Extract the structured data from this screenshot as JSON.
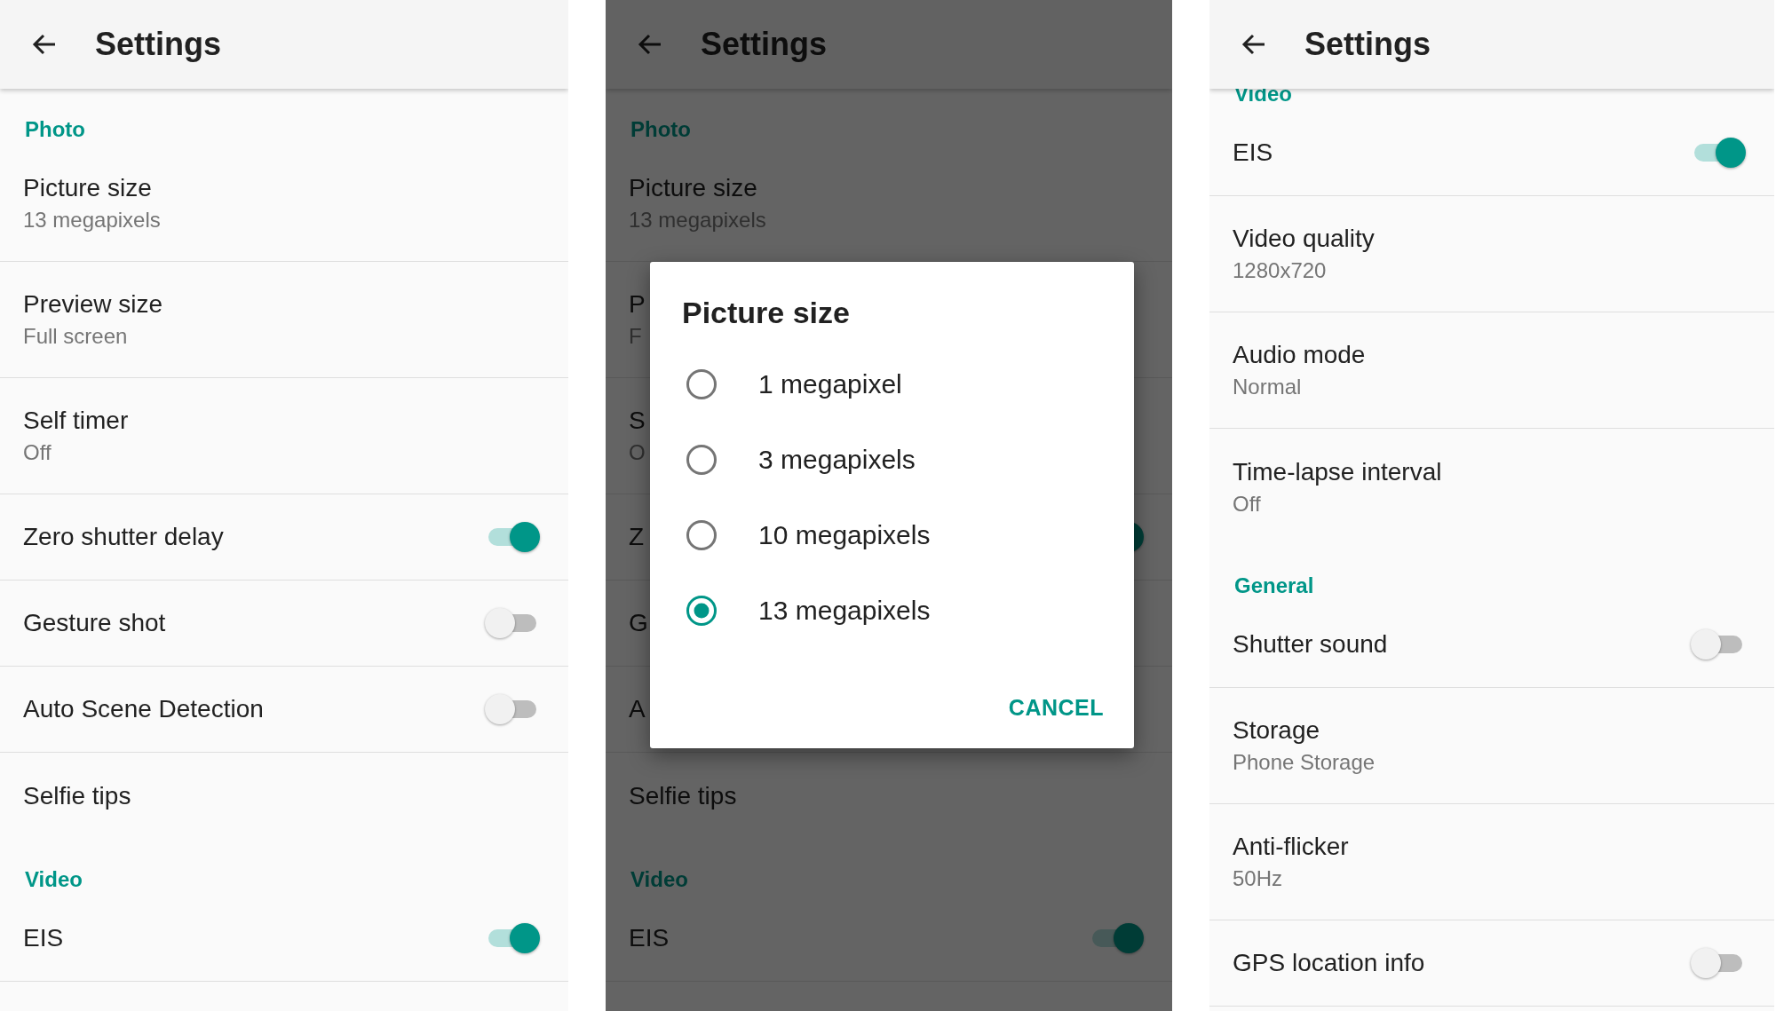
{
  "panels": [
    {
      "title": "Settings",
      "scrolled": false,
      "items": [
        {
          "kind": "category",
          "label": "Photo"
        },
        {
          "kind": "text",
          "label": "Picture size",
          "value": "13 megapixels"
        },
        {
          "kind": "text",
          "label": "Preview size",
          "value": "Full screen"
        },
        {
          "kind": "text",
          "label": "Self timer",
          "value": "Off"
        },
        {
          "kind": "switch",
          "label": "Zero shutter delay",
          "on": true
        },
        {
          "kind": "switch",
          "label": "Gesture shot",
          "on": false
        },
        {
          "kind": "switch",
          "label": "Auto Scene Detection",
          "on": false
        },
        {
          "kind": "text",
          "label": "Selfie tips"
        },
        {
          "kind": "category",
          "label": "Video"
        },
        {
          "kind": "switch",
          "label": "EIS",
          "on": true
        }
      ]
    },
    {
      "title": "Settings",
      "scrolled": false,
      "items": [
        {
          "kind": "category",
          "label": "Photo"
        },
        {
          "kind": "text",
          "label": "Picture size",
          "value": "13 megapixels"
        },
        {
          "kind": "text",
          "label": "P",
          "value": "F"
        },
        {
          "kind": "text",
          "label": "S",
          "value": "O"
        },
        {
          "kind": "switch",
          "label": "Z",
          "on": true
        },
        {
          "kind": "text",
          "label": "G"
        },
        {
          "kind": "text",
          "label": "A"
        },
        {
          "kind": "text",
          "label": "Selfie tips"
        },
        {
          "kind": "category",
          "label": "Video"
        },
        {
          "kind": "switch",
          "label": "EIS",
          "on": true
        }
      ],
      "dialog": {
        "title": "Picture size",
        "options": [
          {
            "label": "1 megapixel",
            "selected": false
          },
          {
            "label": "3 megapixels",
            "selected": false
          },
          {
            "label": "10 megapixels",
            "selected": false
          },
          {
            "label": "13 megapixels",
            "selected": true
          }
        ],
        "button": "CANCEL"
      }
    },
    {
      "title": "Settings",
      "scrolled": true,
      "items": [
        {
          "kind": "category",
          "label": "Video"
        },
        {
          "kind": "switch",
          "label": "EIS",
          "on": true
        },
        {
          "kind": "text",
          "label": "Video quality",
          "value": "1280x720"
        },
        {
          "kind": "text",
          "label": "Audio mode",
          "value": "Normal"
        },
        {
          "kind": "text",
          "label": "Time-lapse interval",
          "value": "Off"
        },
        {
          "kind": "category",
          "label": "General"
        },
        {
          "kind": "switch",
          "label": "Shutter sound",
          "on": false
        },
        {
          "kind": "text",
          "label": "Storage",
          "value": "Phone Storage"
        },
        {
          "kind": "text",
          "label": "Anti-flicker",
          "value": "50Hz"
        },
        {
          "kind": "switch",
          "label": "GPS location info",
          "on": false
        }
      ]
    }
  ]
}
